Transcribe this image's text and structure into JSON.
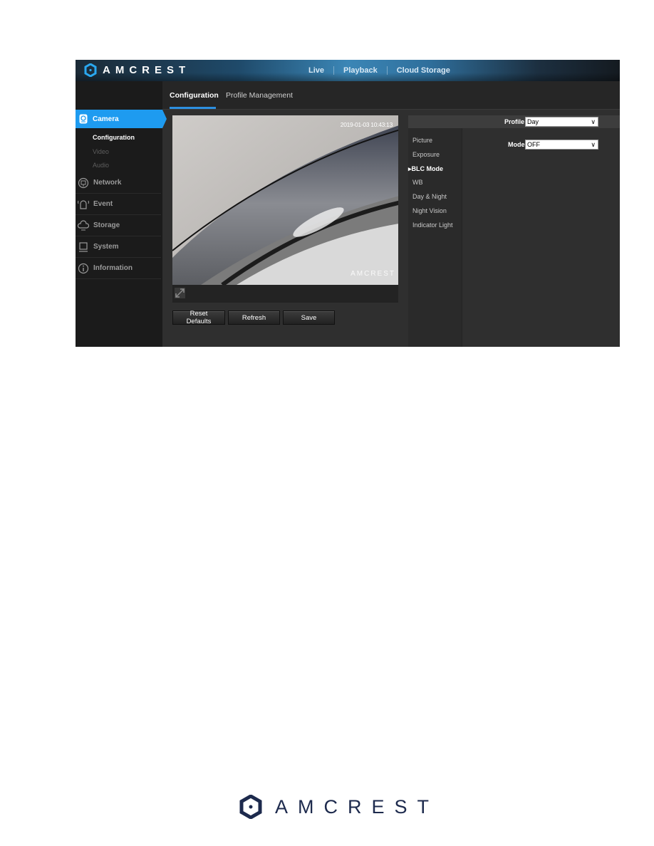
{
  "brand": {
    "name": "AMCREST",
    "accent": "#1e9bf0",
    "footer_color": "#1d2a4d"
  },
  "topnav": {
    "items": [
      "Live",
      "Playback",
      "Cloud Storage"
    ]
  },
  "tabs": [
    {
      "label": "Configuration",
      "active": true
    },
    {
      "label": "Profile Management",
      "active": false
    }
  ],
  "sidebar": {
    "camera": {
      "label": "Camera",
      "icon": "camera-icon",
      "sub": [
        "Configuration",
        "Video",
        "Audio"
      ],
      "active_sub": "Configuration"
    },
    "items": [
      {
        "label": "Network",
        "icon": "network-icon"
      },
      {
        "label": "Event",
        "icon": "alarm-icon"
      },
      {
        "label": "Storage",
        "icon": "cloud-storage-icon"
      },
      {
        "label": "System",
        "icon": "computer-icon"
      },
      {
        "label": "Information",
        "icon": "info-icon"
      }
    ]
  },
  "video": {
    "timestamp": "2019-01-03 10:43:13",
    "watermark": "AMCREST",
    "fullscreen_icon": "fullscreen-icon"
  },
  "buttons": {
    "reset": "Reset Defaults",
    "refresh": "Refresh",
    "save": "Save"
  },
  "settings": {
    "profile_label": "Profile",
    "profile_value": "Day",
    "mode_label": "Mode",
    "mode_value": "OFF",
    "menu": [
      "Picture",
      "Exposure",
      "BLC Mode",
      "WB",
      "Day & Night",
      "Night Vision",
      "Indicator Light"
    ],
    "active_menu": "BLC Mode"
  },
  "footer": {
    "logo_text": "AMCREST"
  }
}
